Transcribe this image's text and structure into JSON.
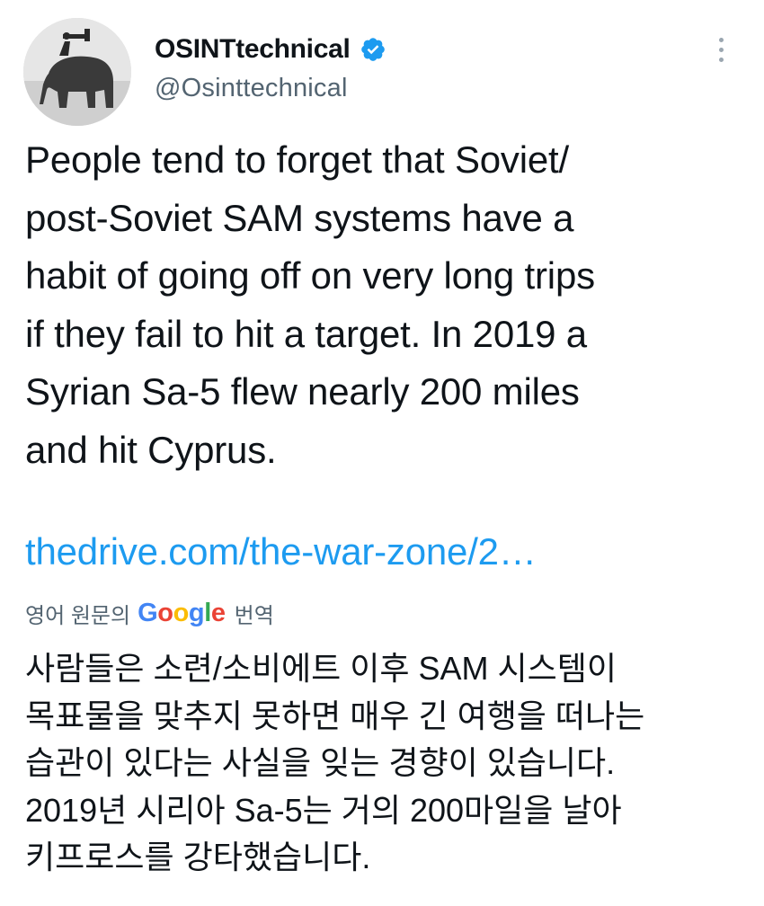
{
  "author": {
    "display_name": "OSINTtechnical",
    "handle": "@Osinttechnical",
    "verified": true
  },
  "icons": {
    "verified": "verified-badge-icon",
    "more": "more-vertical-icon"
  },
  "tweet": {
    "text": "People tend to forget that Soviet/\npost-Soviet SAM systems have a\nhabit of going off on very long trips\nif they fail to hit a target. In 2019 a\nSyrian Sa-5 flew nearly 200 miles\nand hit Cyprus.",
    "link": "thedrive.com/the-war-zone/2…"
  },
  "translation": {
    "prefix": "영어 원문의",
    "google_letters": [
      "G",
      "o",
      "o",
      "g",
      "l",
      "e"
    ],
    "suffix": "번역",
    "text": "사람들은 소련/소비에트 이후 SAM 시스템이\n목표물을 맞추지 못하면 매우 긴 여행을 떠나는\n습관이 있다는 사실을 잊는 경향이 있습니다.\n2019년 시리아 Sa-5는 거의 200마일을 날아\n키프로스를 강타했습니다."
  },
  "colors": {
    "link": "#1d9bf0",
    "verified": "#1d9bf0",
    "secondary_text": "#536471",
    "primary_text": "#0f1419"
  }
}
